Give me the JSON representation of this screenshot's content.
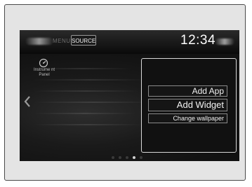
{
  "header": {
    "menu_label": "MENU",
    "source_label": "SOURCE",
    "clock": "12:34"
  },
  "home": {
    "app_icon_label": "Instrume nt Panel",
    "page_count": 5,
    "active_page": 4
  },
  "context_menu": {
    "items": [
      {
        "label": "Add App"
      },
      {
        "label": "Add Widget"
      },
      {
        "label": "Change wallpaper"
      }
    ]
  },
  "colors": {
    "background": "#141414",
    "text": "#f2f2f2",
    "frame": "#e4e4e4"
  },
  "icons": {
    "gauge": "gauge-icon",
    "left_arrow": "chevron-left-icon"
  }
}
